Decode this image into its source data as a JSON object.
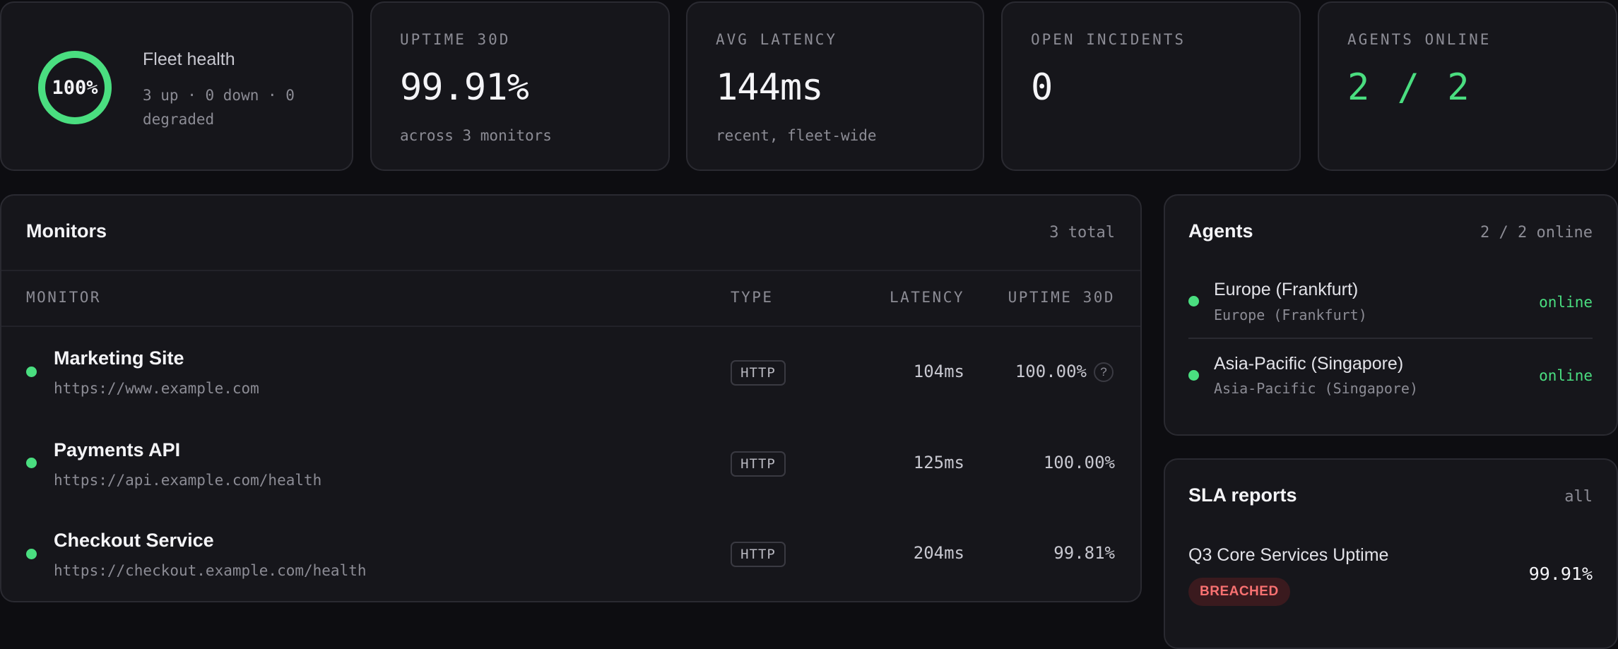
{
  "fleet": {
    "percent_label": "100%",
    "percent": 100,
    "title": "Fleet health",
    "summary": "3 up · 0 down · 0 degraded",
    "ring_color": "#4ade80"
  },
  "stats": [
    {
      "label": "UPTIME 30D",
      "value": "99.91%",
      "sub": "across 3 monitors"
    },
    {
      "label": "AVG LATENCY",
      "value": "144ms",
      "sub": "recent, fleet-wide"
    },
    {
      "label": "OPEN INCIDENTS",
      "value": "0",
      "sub": ""
    },
    {
      "label": "AGENTS ONLINE",
      "value": "2 / 2",
      "sub": "",
      "accent": "#4ade80"
    }
  ],
  "monitors": {
    "title": "Monitors",
    "count": "3 total",
    "columns": [
      "MONITOR",
      "TYPE",
      "LATENCY",
      "UPTIME 30D"
    ],
    "rows": [
      {
        "name": "Marketing Site",
        "url": "https://www.example.com",
        "type": "HTTP",
        "latency": "104ms",
        "uptime": "100.00%",
        "status": "up",
        "help": "?"
      },
      {
        "name": "Payments API",
        "url": "https://api.example.com/health",
        "type": "HTTP",
        "latency": "125ms",
        "uptime": "100.00%",
        "status": "up"
      },
      {
        "name": "Checkout Service",
        "url": "https://checkout.example.com/health",
        "type": "HTTP",
        "latency": "204ms",
        "uptime": "99.81%",
        "status": "up"
      }
    ]
  },
  "agents": {
    "title": "Agents",
    "count": "2 / 2 online",
    "items": [
      {
        "name": "Europe (Frankfurt)",
        "region": "Europe (Frankfurt)",
        "status": "online"
      },
      {
        "name": "Asia-Pacific (Singapore)",
        "region": "Asia-Pacific (Singapore)",
        "status": "online"
      }
    ]
  },
  "sla": {
    "title": "SLA reports",
    "filter": "all",
    "reports": [
      {
        "name": "Q3 Core Services Uptime",
        "status": "BREACHED",
        "value": "99.91%"
      }
    ]
  },
  "colors": {
    "up": "#4ade80",
    "breached": "#f87171",
    "background": "#0d0d11",
    "card": "#16161b"
  }
}
